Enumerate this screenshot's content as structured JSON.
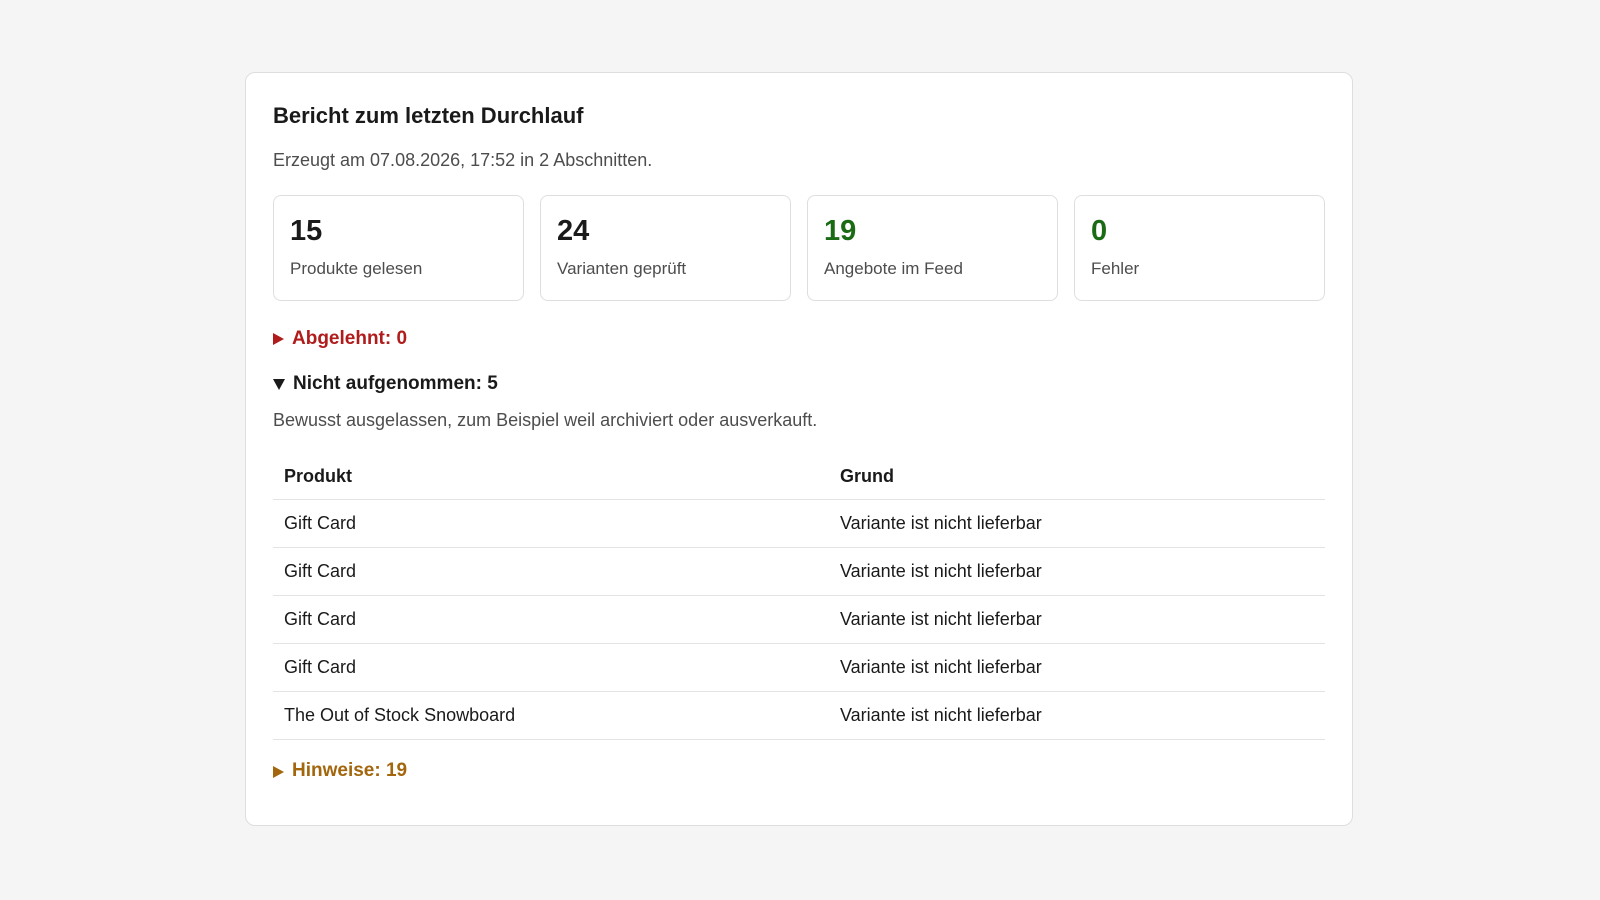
{
  "report": {
    "title": "Bericht zum letzten Durchlauf",
    "subtitle": "Erzeugt am 07.08.2026, 17:52 in 2 Abschnitten."
  },
  "stats": [
    {
      "value": "15",
      "label": "Produkte gelesen",
      "color": "#1a1a1a"
    },
    {
      "value": "24",
      "label": "Varianten geprüft",
      "color": "#1a1a1a"
    },
    {
      "value": "19",
      "label": "Angebote im Feed",
      "color": "#1a6b14"
    },
    {
      "value": "0",
      "label": "Fehler",
      "color": "#1a6b14"
    }
  ],
  "sections": {
    "rejected": {
      "label": "Abgelehnt: 0",
      "expanded": false,
      "color": "#b01c1c",
      "icon": "triangle-right-icon"
    },
    "excluded": {
      "label": "Nicht aufgenommen: 5",
      "expanded": true,
      "icon": "triangle-down-icon",
      "note": "Bewusst ausgelassen, zum Beispiel weil archiviert oder ausverkauft.",
      "table": {
        "headers": [
          "Produkt",
          "Grund"
        ],
        "rows": [
          [
            "Gift Card",
            "Variante ist nicht lieferbar"
          ],
          [
            "Gift Card",
            "Variante ist nicht lieferbar"
          ],
          [
            "Gift Card",
            "Variante ist nicht lieferbar"
          ],
          [
            "Gift Card",
            "Variante ist nicht lieferbar"
          ],
          [
            "The Out of Stock Snowboard",
            "Variante ist nicht lieferbar"
          ]
        ]
      }
    },
    "hints": {
      "label": "Hinweise: 19",
      "expanded": false,
      "color": "#a3660c",
      "icon": "triangle-right-icon"
    }
  }
}
